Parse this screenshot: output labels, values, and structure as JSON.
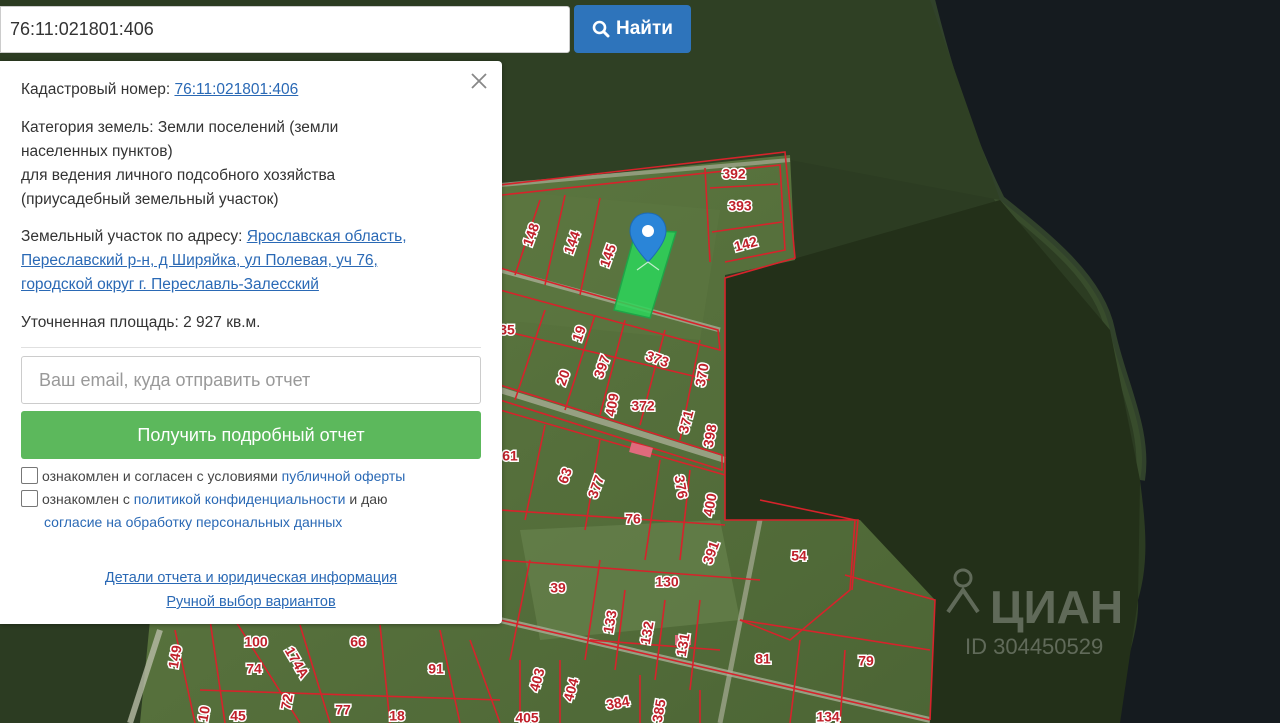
{
  "search": {
    "value": "76:11:021801:406",
    "button_label": "Найти",
    "button_icon": "search-icon"
  },
  "popup": {
    "cadastral_label": "Кадастровый номер:",
    "cadastral_number": "76:11:021801:406",
    "category_label": "Категория земель:",
    "category_lines": [
      "Земли поселений (земли",
      "населенных пунктов)",
      "для ведения личного подсобного хозяйства",
      "(приусадебный земельный участок)"
    ],
    "address_label": "Земельный участок по адресу:",
    "address_lines": [
      "Ярославская область,",
      "Переславский р-н, д Ширяйка, ул Полевая, уч 76,",
      "городской округ г. Переславль-Залесский"
    ],
    "area_label": "Уточненная площадь:",
    "area_value": "2 927 кв.м.",
    "email_placeholder": "Ваш email, куда отправить отчет",
    "report_button": "Получить подробный отчет",
    "consent1_text": "ознакомлен и согласен с условиями ",
    "consent1_link": "публичной оферты",
    "consent2_text": "ознакомлен с ",
    "consent2_link": "политикой конфиденциальности",
    "consent2_tail": " и даю",
    "consent2_link2": "согласие на обработку персональных данных",
    "details_link": "Детали отчета и юридическая информация",
    "manual_link": "Ручной выбор вариантов"
  },
  "map": {
    "parcel_labels": [
      {
        "id": "392",
        "rot": 0
      },
      {
        "id": "393",
        "rot": 0
      },
      {
        "id": "142",
        "rot": -15
      },
      {
        "id": "148",
        "rot": -70
      },
      {
        "id": "144",
        "rot": -70
      },
      {
        "id": "145",
        "rot": -70
      },
      {
        "id": "19",
        "rot": -70
      },
      {
        "id": "397",
        "rot": -70
      },
      {
        "id": "373",
        "rot": 20
      },
      {
        "id": "370",
        "rot": -80
      },
      {
        "id": "20",
        "rot": -70
      },
      {
        "id": "409",
        "rot": -80
      },
      {
        "id": "372",
        "rot": 0
      },
      {
        "id": "371",
        "rot": -75
      },
      {
        "id": "398",
        "rot": -80
      },
      {
        "id": "61",
        "rot": 0
      },
      {
        "id": "63",
        "rot": -70
      },
      {
        "id": "377",
        "rot": -70
      },
      {
        "id": "376",
        "rot": 80
      },
      {
        "id": "400",
        "rot": -80
      },
      {
        "id": "76",
        "rot": 0
      },
      {
        "id": "391",
        "rot": -70
      },
      {
        "id": "54",
        "rot": 0
      },
      {
        "id": "39",
        "rot": 0
      },
      {
        "id": "130",
        "rot": 0
      },
      {
        "id": "133",
        "rot": -80
      },
      {
        "id": "132",
        "rot": -80
      },
      {
        "id": "131",
        "rot": -80
      },
      {
        "id": "81",
        "rot": 0
      },
      {
        "id": "79",
        "rot": 0
      },
      {
        "id": "100",
        "rot": 0
      },
      {
        "id": "66",
        "rot": 0
      },
      {
        "id": "149",
        "rot": -80
      },
      {
        "id": "174A",
        "rot": 60
      },
      {
        "id": "74",
        "rot": 0
      },
      {
        "id": "91",
        "rot": 0
      },
      {
        "id": "403",
        "rot": -75
      },
      {
        "id": "404",
        "rot": -75
      },
      {
        "id": "384",
        "rot": -10
      },
      {
        "id": "385",
        "rot": -80
      },
      {
        "id": "72",
        "rot": -80
      },
      {
        "id": "77",
        "rot": 0
      },
      {
        "id": "18",
        "rot": 0
      },
      {
        "id": "405",
        "rot": 0
      },
      {
        "id": "134",
        "rot": 0
      },
      {
        "id": "10",
        "rot": -80
      },
      {
        "id": "45",
        "rot": 0
      },
      {
        "id": "35",
        "rot": 0
      }
    ],
    "watermark_brand": "ЦИАН",
    "watermark_id": "ID 304450529",
    "colors": {
      "parcel_border": "#d6232b",
      "selected_parcel": "#2bd65a",
      "marker": "#2a85d8",
      "water": "#141a1e",
      "forest": "#27361e"
    }
  }
}
